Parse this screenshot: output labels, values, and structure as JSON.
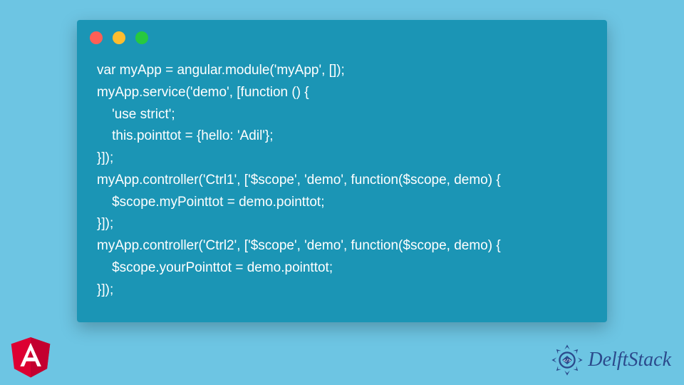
{
  "code": "var myApp = angular.module('myApp', []);\nmyApp.service('demo', [function () {\n    'use strict';\n    this.pointtot = {hello: 'Adil'};\n}]);\nmyApp.controller('Ctrl1', ['$scope', 'demo', function($scope, demo) {\n    $scope.myPointtot = demo.pointtot;\n}]);\nmyApp.controller('Ctrl2', ['$scope', 'demo', function($scope, demo) {\n    $scope.yourPointtot = demo.pointtot;\n}]);",
  "brand": {
    "name": "DelftStack"
  }
}
